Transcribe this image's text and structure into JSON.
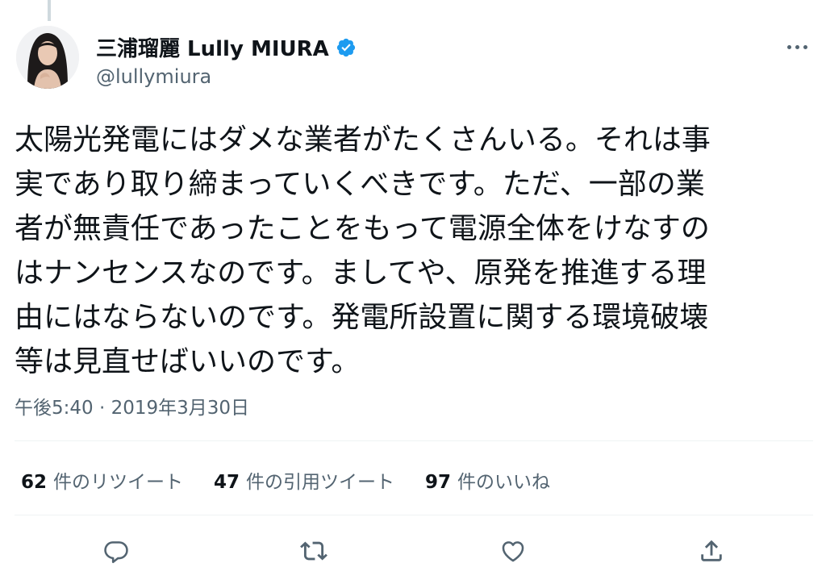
{
  "author": {
    "display_name": "三浦瑠麗 Lully MIURA",
    "handle": "@lullymiura",
    "verified": true
  },
  "tweet": {
    "text": "太陽光発電にはダメな業者がたくさんいる。それは事\n実であり取り締まっていくべきです。ただ、一部の業\n者が無責任であったことをもって電源全体をけなすの\nはナンセンスなのです。ましてや、原発を推進する理\n由にはならないのです。発電所設置に関する環境破壊\n等は見直せばいいのです。",
    "timestamp": "午後5:40 · 2019年3月30日"
  },
  "stats": {
    "retweets": {
      "count": "62",
      "label": "件のリツイート"
    },
    "quotes": {
      "count": "47",
      "label": "件の引用ツイート"
    },
    "likes": {
      "count": "97",
      "label": "件のいいね"
    }
  },
  "icons": {
    "more": "more-horizontal-icon",
    "verified": "verified-badge-icon",
    "reply": "reply-icon",
    "retweet": "retweet-icon",
    "like": "heart-icon",
    "share": "share-icon"
  },
  "colors": {
    "verified": "#1d9bf0",
    "secondary_text": "#536471",
    "primary_text": "#0f1419"
  }
}
